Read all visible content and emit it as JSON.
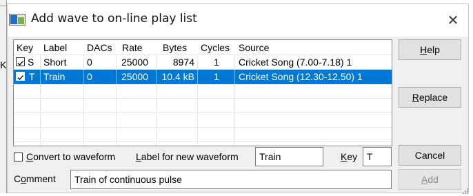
{
  "background_left": {
    "partial_text": "Key"
  },
  "window": {
    "title": "Add wave to on-line play list",
    "close_glyph": "✕"
  },
  "list": {
    "columns": [
      "Key",
      "Label",
      "DACs",
      "Rate",
      "Bytes",
      "Cycles",
      "Source"
    ],
    "rows": [
      {
        "checked": true,
        "key": "S",
        "label": "Short",
        "dacs": "0",
        "rate": "25000",
        "bytes": "8974",
        "cycles": "1",
        "source": "Cricket Song (7.00-7.18) 1",
        "selected": false
      },
      {
        "checked": true,
        "key": "T",
        "label": "Train",
        "dacs": "0",
        "rate": "25000",
        "bytes": "10.4 kB",
        "cycles": "1",
        "source": "Cricket Song (12.30-12.50) 1",
        "selected": true
      }
    ]
  },
  "buttons": {
    "help": {
      "before": "",
      "mnemonic": "H",
      "after": "elp"
    },
    "replace": {
      "before": "",
      "mnemonic": "R",
      "after": "eplace"
    },
    "cancel": {
      "label": "Cancel"
    },
    "add": {
      "before": "",
      "mnemonic": "A",
      "after": "dd"
    }
  },
  "form": {
    "convert": {
      "checked": false,
      "before": "",
      "mnemonic": "C",
      "after": "onvert to waveform"
    },
    "label_new": {
      "before": "",
      "mnemonic": "L",
      "after": "abel for new waveform"
    },
    "label_value": "Train",
    "key_label": {
      "before": "",
      "mnemonic": "K",
      "after": "ey"
    },
    "key_value": "T",
    "comment_label": {
      "before": "C",
      "mnemonic": "o",
      "after": "mment"
    },
    "comment_value": "Train of continuous pulse"
  },
  "colors": {
    "selection": "#0078d7",
    "dialog_bg": "#f0f0f0",
    "button_bg": "#e1e1e1"
  }
}
